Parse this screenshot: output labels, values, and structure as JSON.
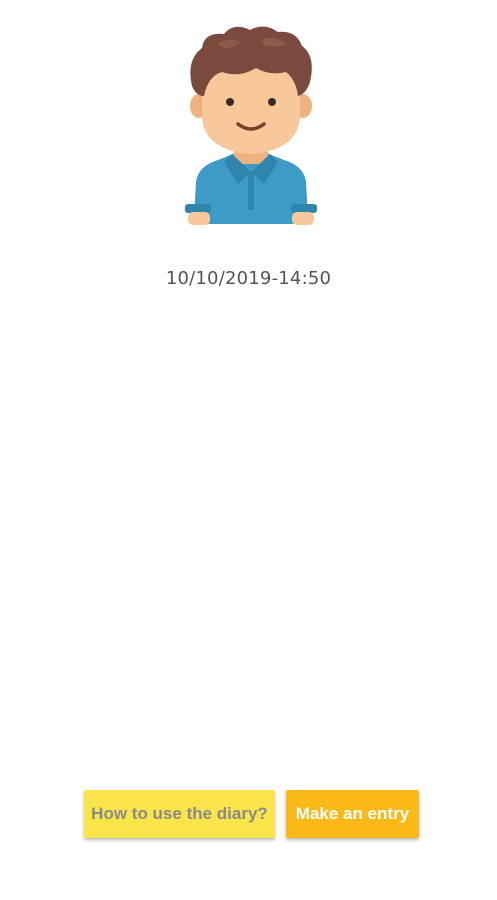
{
  "profile": {
    "avatar_icon": "boy-avatar-icon",
    "timestamp": "10/10/2019-14:50"
  },
  "actions": {
    "help_label": "How to use the diary?",
    "entry_label": "Make an entry"
  },
  "colors": {
    "help_button_bg": "#f9e44a",
    "entry_button_bg": "#fbb918",
    "shirt": "#3d9cc7",
    "hair": "#7a4a3e",
    "skin": "#f8c89a"
  }
}
